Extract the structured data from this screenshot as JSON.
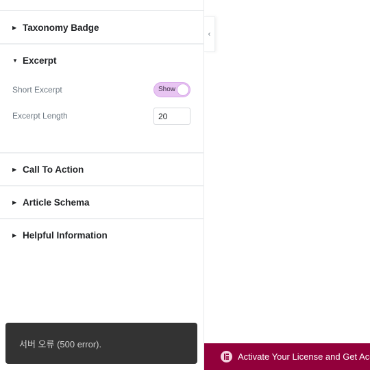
{
  "panel": {
    "sections": {
      "taxonomy_badge": "Taxonomy Badge",
      "excerpt": "Excerpt",
      "call_to_action": "Call To Action",
      "article_schema": "Article Schema",
      "helpful_information": "Helpful Information"
    },
    "excerpt": {
      "short_excerpt_label": "Short Excerpt",
      "short_excerpt_toggle": "Show",
      "short_excerpt_on": true,
      "excerpt_length_label": "Excerpt Length",
      "excerpt_length_value": "20"
    }
  },
  "collapse_icon": "chevron-left-icon",
  "toast": {
    "message": "서버 오류 (500 error)."
  },
  "license_bar": {
    "text": "Activate Your License and Get Access",
    "icon": "elementor-icon",
    "background": "#92003b"
  },
  "colors": {
    "toggle_on": "#e8c5f2",
    "toast_bg": "#333333"
  }
}
